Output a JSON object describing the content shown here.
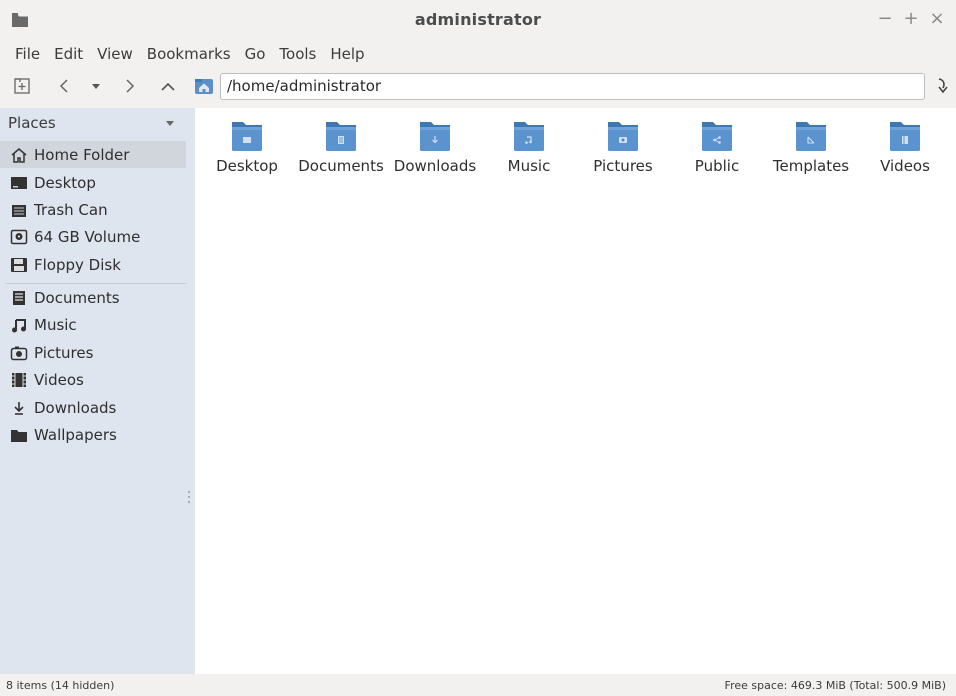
{
  "window": {
    "title": "administrator",
    "controls": [
      "−",
      "+",
      "×"
    ]
  },
  "menu": [
    "File",
    "Edit",
    "View",
    "Bookmarks",
    "Go",
    "Tools",
    "Help"
  ],
  "toolbar": {
    "path": "/home/administrator"
  },
  "sidebar": {
    "header": "Places",
    "places": [
      {
        "label": "Home Folder",
        "icon": "home-icon",
        "selected": true
      },
      {
        "label": "Desktop",
        "icon": "desktop-icon"
      },
      {
        "label": "Trash Can",
        "icon": "trash-icon"
      },
      {
        "label": "64 GB Volume",
        "icon": "drive-icon"
      },
      {
        "label": "Floppy Disk",
        "icon": "floppy-icon"
      }
    ],
    "bookmarks": [
      {
        "label": "Documents",
        "icon": "document-icon"
      },
      {
        "label": "Music",
        "icon": "music-icon"
      },
      {
        "label": "Pictures",
        "icon": "camera-icon"
      },
      {
        "label": "Videos",
        "icon": "film-icon"
      },
      {
        "label": "Downloads",
        "icon": "download-icon"
      },
      {
        "label": "Wallpapers",
        "icon": "folder-icon"
      }
    ]
  },
  "folders": [
    {
      "label": "Desktop",
      "emblem": "desktop-icon"
    },
    {
      "label": "Documents",
      "emblem": "document-icon"
    },
    {
      "label": "Downloads",
      "emblem": "download-icon"
    },
    {
      "label": "Music",
      "emblem": "music-icon"
    },
    {
      "label": "Pictures",
      "emblem": "camera-icon"
    },
    {
      "label": "Public",
      "emblem": "share-icon"
    },
    {
      "label": "Templates",
      "emblem": "template-icon"
    },
    {
      "label": "Videos",
      "emblem": "film-icon"
    }
  ],
  "status": {
    "items": "8 items (14 hidden)",
    "free_space": "Free space: 469.3 MiB (Total: 500.9 MiB)"
  },
  "colors": {
    "sidebar_bg": "#dee5ee",
    "folder_blue": "#4a86c5",
    "selected_bg": "#d1d6dc"
  }
}
